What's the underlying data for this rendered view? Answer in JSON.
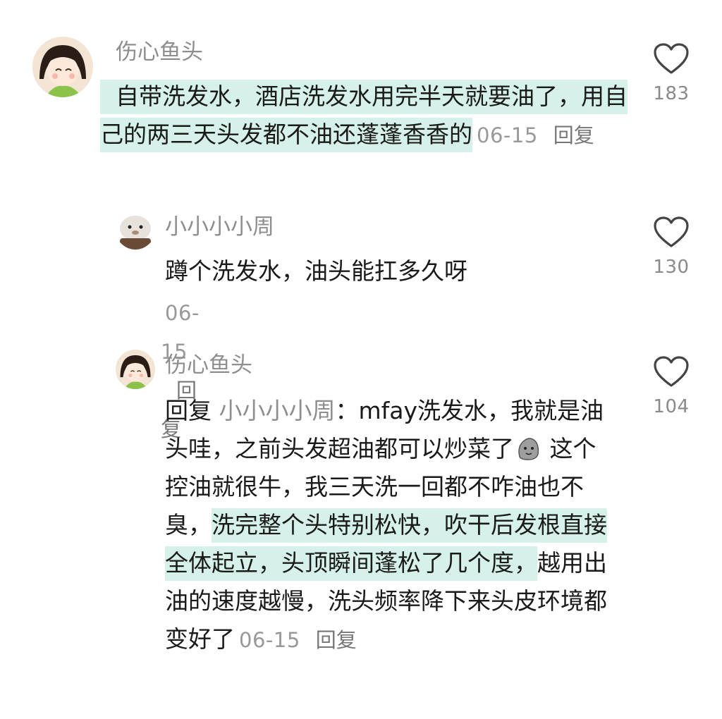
{
  "comments": [
    {
      "username": "伤心鱼头",
      "text_part1": "自带洗发水，酒店洗发水用完半天就要油了，用自己的两三天头发都不油还蓬蓬香香的",
      "date": "06-15",
      "reply": "回复",
      "likes": "183"
    },
    {
      "username": "小小小小周",
      "text": "蹲个洗发水，油头能扛多久呀",
      "date": "06-15",
      "reply": "回复",
      "likes": "130"
    },
    {
      "username": "伤心鱼头",
      "reply_prefix": "回复",
      "reply_to": "小小小小周",
      "text_a": "：mfay洗发水，我就是油头哇，之前头发超油都可以炒菜了",
      "text_b": " 这个控油就很牛，我三天洗一回都不咋油也不臭，",
      "text_highlight": "洗完整个头特别松快，吹干后发根直接全体起立，头顶瞬间蓬松了几个度，",
      "text_c": "越用出油的速度越慢，洗头频率降下来头皮环境都变好了",
      "date": "06-15",
      "reply": "回复",
      "likes": "104"
    }
  ],
  "icons": {
    "like": "heart-outline-icon",
    "emoji": "blob-emoji-icon"
  },
  "colors": {
    "highlight": "#d6f1e9",
    "meta": "#999999",
    "username": "#8e8e8e"
  }
}
